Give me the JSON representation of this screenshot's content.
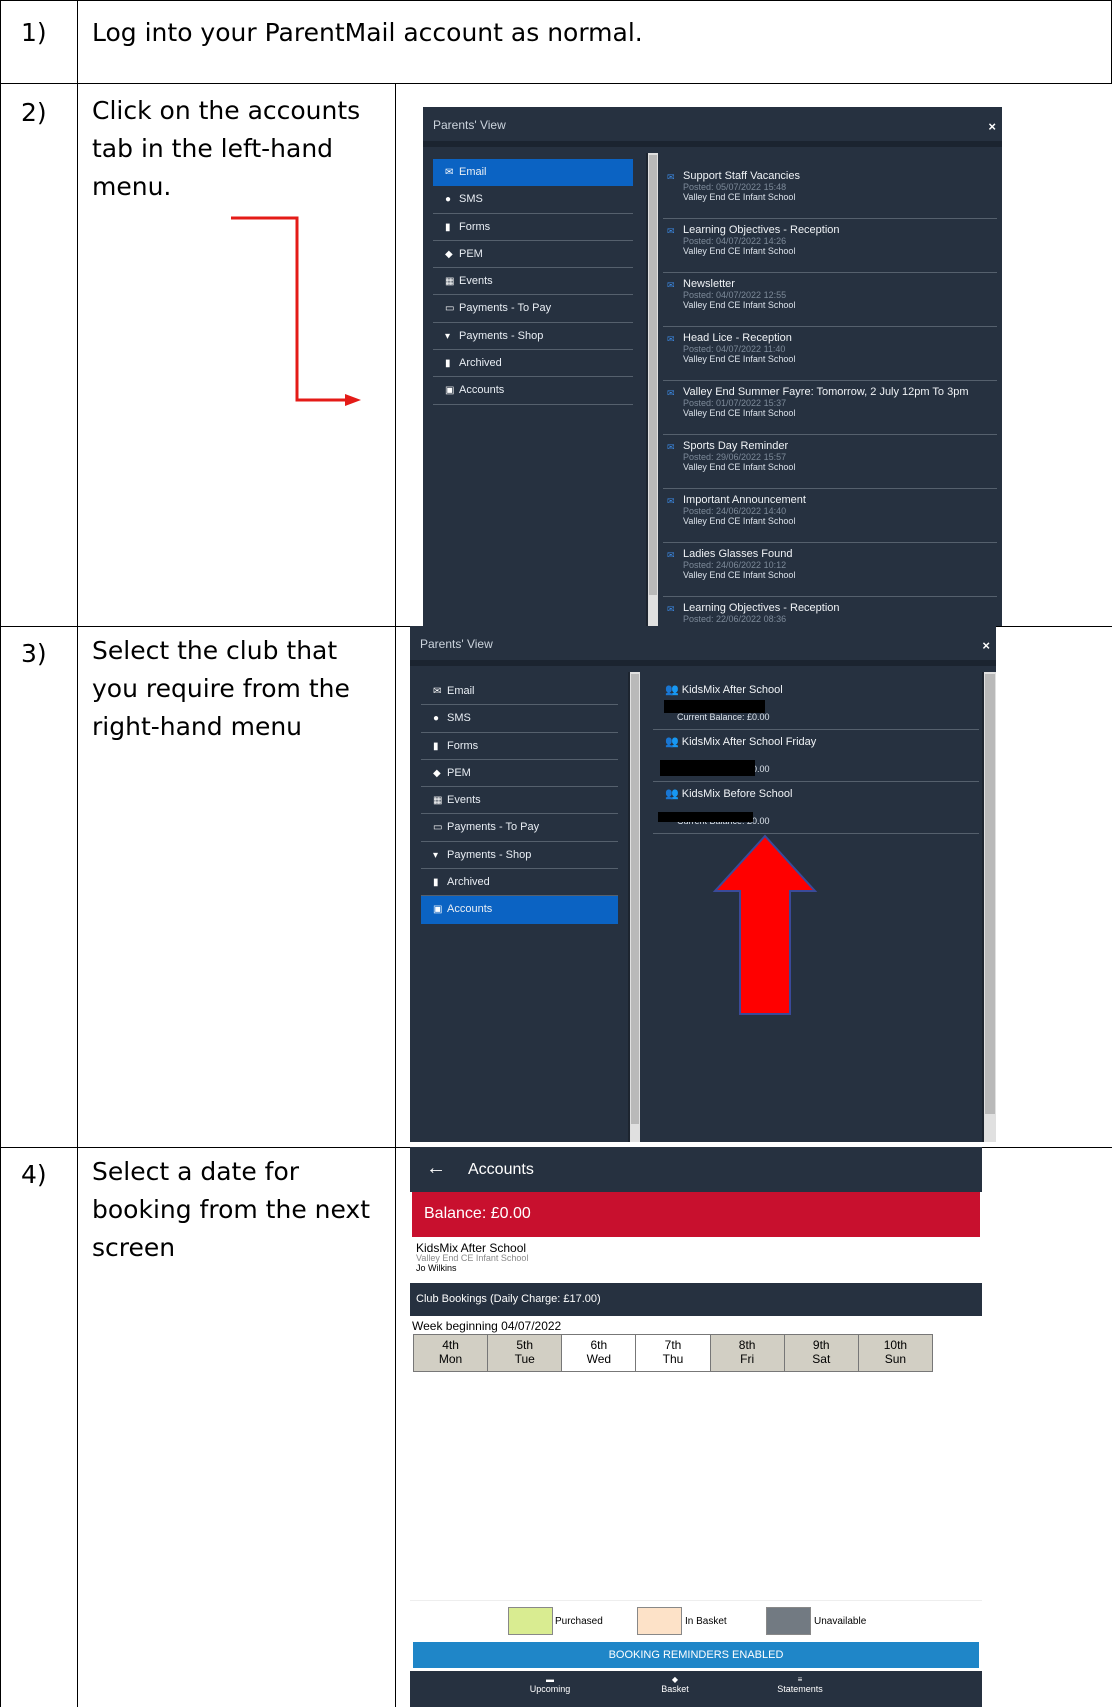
{
  "steps": [
    {
      "number": "1)",
      "text": "Log into your ParentMail account as normal."
    },
    {
      "number": "2)",
      "text": "Click on the accounts tab in the left-hand menu."
    },
    {
      "number": "3)",
      "text": "Select the club that you require from the right-hand menu"
    },
    {
      "number": "4)",
      "text": "Select a date for booking from the next screen"
    }
  ],
  "panel_a": {
    "title": "Parents' View",
    "close": "×",
    "menu": [
      "Email",
      "SMS",
      "Forms",
      "PEM",
      "Events",
      "Payments - To Pay",
      "Payments - Shop",
      "Archived",
      "Accounts"
    ],
    "messages": [
      {
        "title": "Support Staff Vacancies",
        "posted": "Posted: 05/07/2022 15:48",
        "school": "Valley End CE Infant School"
      },
      {
        "title": "Learning Objectives - Reception",
        "posted": "Posted: 04/07/2022 14:26",
        "school": "Valley End CE Infant School"
      },
      {
        "title": "Newsletter",
        "posted": "Posted: 04/07/2022 12:55",
        "school": "Valley End CE Infant School"
      },
      {
        "title": "Head Lice - Reception",
        "posted": "Posted: 04/07/2022 11:40",
        "school": "Valley End CE Infant School"
      },
      {
        "title": "Valley End Summer Fayre: Tomorrow, 2 July 12pm To 3pm",
        "posted": "Posted: 01/07/2022 15:37",
        "school": "Valley End CE Infant School"
      },
      {
        "title": "Sports Day Reminder",
        "posted": "Posted: 29/06/2022 15:57",
        "school": "Valley End CE Infant School"
      },
      {
        "title": "Important Announcement",
        "posted": "Posted: 24/06/2022 14:40",
        "school": "Valley End CE Infant School"
      },
      {
        "title": "Ladies Glasses Found",
        "posted": "Posted: 24/06/2022 10:12",
        "school": "Valley End CE Infant School"
      },
      {
        "title": "Learning Objectives - Reception",
        "posted": "Posted: 22/06/2022 08:36",
        "school": ""
      }
    ]
  },
  "panel_b": {
    "title": "Parents' View",
    "close": "×",
    "menu": [
      "Email",
      "SMS",
      "Forms",
      "PEM",
      "Events",
      "Payments - To Pay",
      "Payments - Shop",
      "Archived",
      "Accounts"
    ],
    "clubs": [
      {
        "name": "KidsMix After School",
        "balance": "Current Balance: £0.00"
      },
      {
        "name": "KidsMix After School Friday",
        "balance": "Current Balance: £0.00"
      },
      {
        "name": "KidsMix Before School",
        "balance": "Current Balance: £0.00"
      }
    ]
  },
  "accounts": {
    "back": "←",
    "title": "Accounts",
    "balance": "Balance: £0.00",
    "club_name": "KidsMix After School",
    "club_school": "Valley End CE Infant School",
    "club_person": "Jo Wilkins",
    "bookings_header": "Club Bookings (Daily Charge: £17.00)",
    "week": "Week beginning 04/07/2022",
    "days": [
      [
        "4th",
        "Mon"
      ],
      [
        "5th",
        "Tue"
      ],
      [
        "6th",
        "Wed"
      ],
      [
        "7th",
        "Thu"
      ],
      [
        "8th",
        "Fri"
      ],
      [
        "9th",
        "Sat"
      ],
      [
        "10th",
        "Sun"
      ]
    ],
    "legend": [
      "Purchased",
      "In Basket",
      "Unavailable"
    ],
    "reminder": "BOOKING REMINDERS ENABLED",
    "tabs": [
      "Upcoming",
      "Basket",
      "Statements"
    ],
    "colors": {
      "balance_bar": "#c8102e",
      "purchased": "#d9ec91",
      "in_basket": "#fde2c8",
      "unavailable": "#727a82",
      "reminder": "#1f86c8"
    }
  }
}
